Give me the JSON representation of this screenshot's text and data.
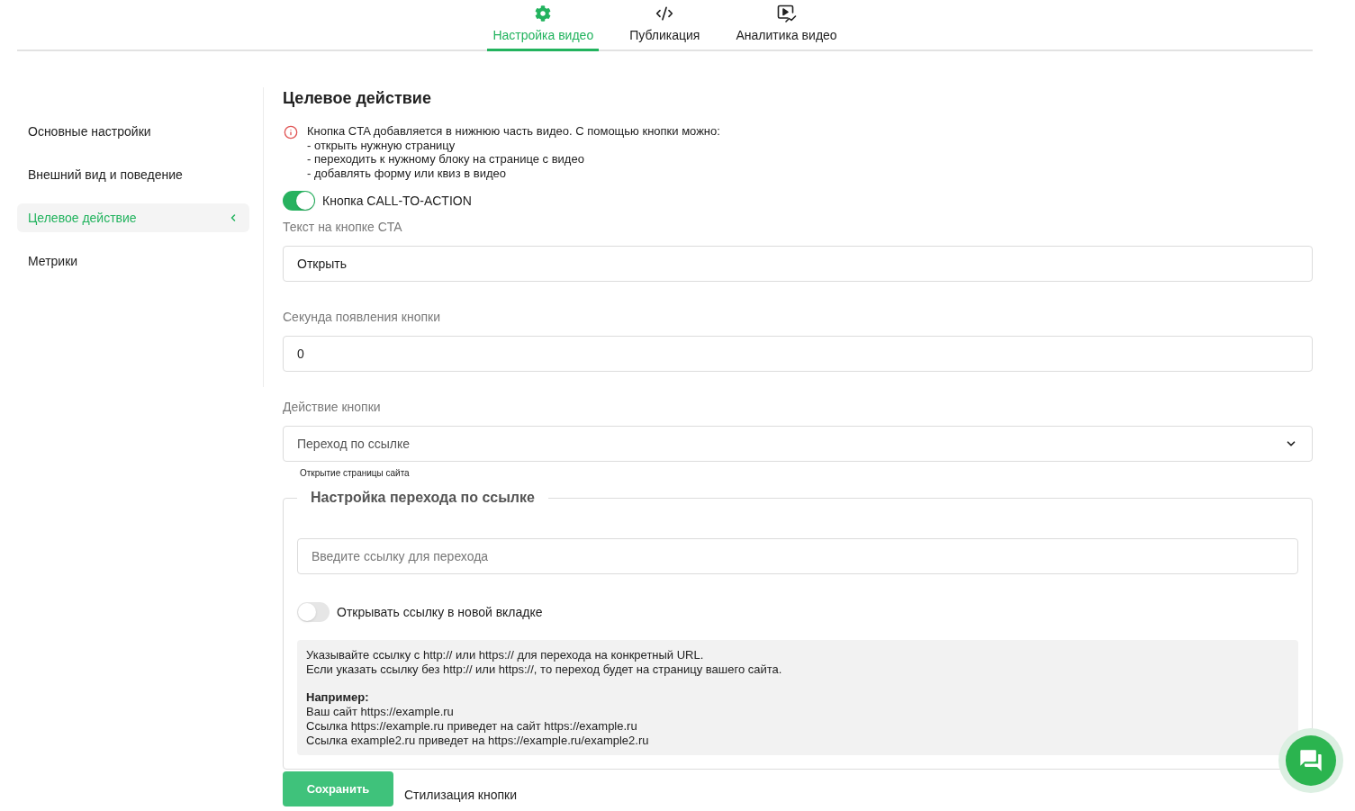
{
  "tabs": [
    {
      "label": "Настройка видео",
      "selected": true
    },
    {
      "label": "Публикация",
      "selected": false
    },
    {
      "label": "Аналитика видео",
      "selected": false
    }
  ],
  "sidebar": {
    "items": [
      {
        "label": "Основные настройки",
        "selected": false
      },
      {
        "label": "Внешний вид и поведение",
        "selected": false
      },
      {
        "label": "Целевое действие",
        "selected": true
      },
      {
        "label": "Метрики",
        "selected": false
      }
    ]
  },
  "section": {
    "title": "Целевое действие",
    "notice": {
      "lines": [
        "Кнопка CTA добавляется в нижнюю часть видео. С помощью кнопки можно:",
        "- открыть нужную страницу",
        "- переходить к нужному блоку на странице с видео",
        "- добавлять форму или квиз в видео"
      ]
    },
    "cta_toggle": {
      "label": "Кнопка CALL-TO-ACTION",
      "on": true
    },
    "fields": [
      {
        "kind": "input",
        "label": "Текст на кнопке CTA",
        "value": "Открыть"
      },
      {
        "kind": "input",
        "label": "Секунда появления кнопки",
        "value": "0"
      },
      {
        "kind": "select",
        "label": "Действие кнопки",
        "value": "Переход по ссылке",
        "hint": "Открытие страницы сайта"
      }
    ],
    "link_settings": {
      "title": "Настройка перехода по ссылке",
      "url_field": {
        "placeholder": "Введите ссылку для перехода"
      },
      "new_tab_toggle": {
        "label": "Открывать ссылку в новой вкладке",
        "on": false
      },
      "info_box": {
        "paragraphs": [
          {
            "lines": [
              "Указывайте ссылку с http:// или https:// для перехода на конкретный URL.",
              "Если указать ссылку без http:// или https://, то переход будет на страницу вашего сайта."
            ]
          },
          {
            "heading": "Например:",
            "lines": [
              "Ваш сайт https://example.ru",
              "Ссылка https://example.ru приведет на сайт https://example.ru",
              "Ссылка example2.ru приведет на https://example.ru/example2.ru"
            ]
          }
        ]
      }
    }
  },
  "save_button": "Сохранить",
  "next_section_title": "Стилизация кнопки"
}
